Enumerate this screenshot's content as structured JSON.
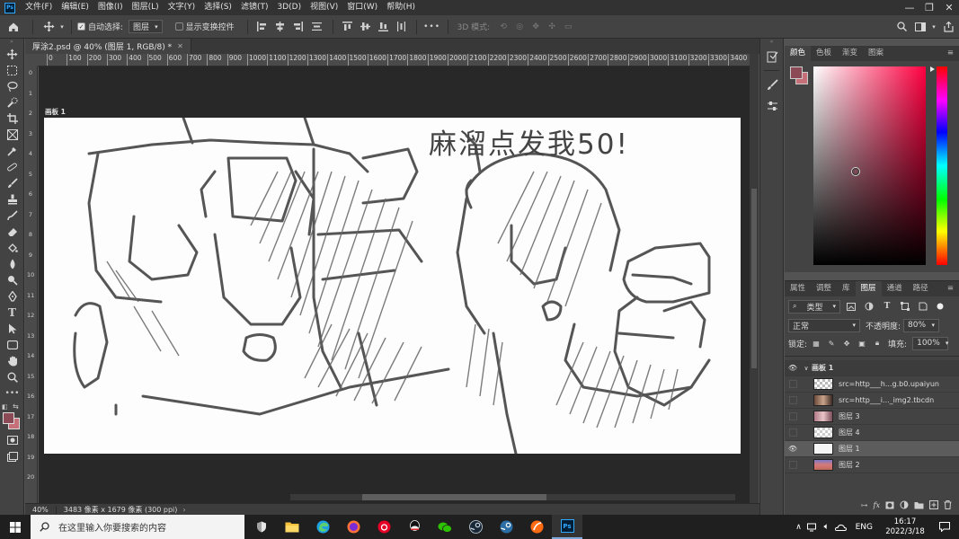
{
  "app": {
    "logo": "Ps",
    "menu": [
      "文件(F)",
      "编辑(E)",
      "图像(I)",
      "图层(L)",
      "文字(Y)",
      "选择(S)",
      "滤镜(T)",
      "3D(D)",
      "视图(V)",
      "窗口(W)",
      "帮助(H)"
    ]
  },
  "options": {
    "auto_select_label": "自动选择:",
    "auto_select_value": "图层",
    "transform_label": "显示变换控件",
    "mode_3d_label": "3D 模式:",
    "more": "•••"
  },
  "document": {
    "tab_title": "厚涂2.psd @ 40% (图层 1, RGB/8) *",
    "artboard_label": "画板 1",
    "sketch_text": "麻溜点发我50!",
    "zoom": "40%",
    "dimensions": "3483 像素 x 1679 像素 (300 ppi)"
  },
  "ruler": {
    "h_labels": [
      "0",
      "100",
      "200",
      "300",
      "400",
      "500",
      "600",
      "700",
      "800",
      "900",
      "1000",
      "1100",
      "1200",
      "1300",
      "1400",
      "1500",
      "1600",
      "1700",
      "1800",
      "1900",
      "2000",
      "2100",
      "2200",
      "2300",
      "2400",
      "2500",
      "2600",
      "2700",
      "2800",
      "2900",
      "3000",
      "3100",
      "3200",
      "3300",
      "3400"
    ],
    "v_labels": [
      "0",
      "1",
      "2",
      "3",
      "4",
      "5",
      "6",
      "7",
      "8",
      "9",
      "10",
      "11",
      "12",
      "13",
      "14",
      "15",
      "16",
      "17",
      "18",
      "19",
      "20"
    ]
  },
  "color_panel": {
    "tabs": [
      "颜色",
      "色板",
      "渐变",
      "图案"
    ],
    "active_tab": "颜色",
    "foreground_color": "#8b4a55",
    "background_color": "#c76f78",
    "hue_color": "#ff0040"
  },
  "layers_panel": {
    "tabs": [
      "属性",
      "调整",
      "库",
      "图层",
      "通道",
      "路径"
    ],
    "active_tab": "图层",
    "filter_kind": "类型",
    "blend_mode": "正常",
    "opacity_label": "不透明度:",
    "opacity_value": "80%",
    "lock_label": "锁定:",
    "fill_label": "填充:",
    "fill_value": "100%",
    "group_name": "画板 1",
    "layers": [
      {
        "name": "src=http___h...g.b0.upaiyun",
        "visible": false,
        "selected": false
      },
      {
        "name": "src=http___i..._img2.tbcdn",
        "visible": false,
        "selected": false
      },
      {
        "name": "图层 3",
        "visible": false,
        "selected": false
      },
      {
        "name": "图层 4",
        "visible": false,
        "selected": false
      },
      {
        "name": "图层 1",
        "visible": true,
        "selected": true
      },
      {
        "name": "图层 2",
        "visible": false,
        "selected": false
      }
    ]
  },
  "taskbar": {
    "search_placeholder": "在这里输入你要搜索的内容",
    "time": "16:17",
    "date": "2022/3/18",
    "lang": "ENG"
  }
}
